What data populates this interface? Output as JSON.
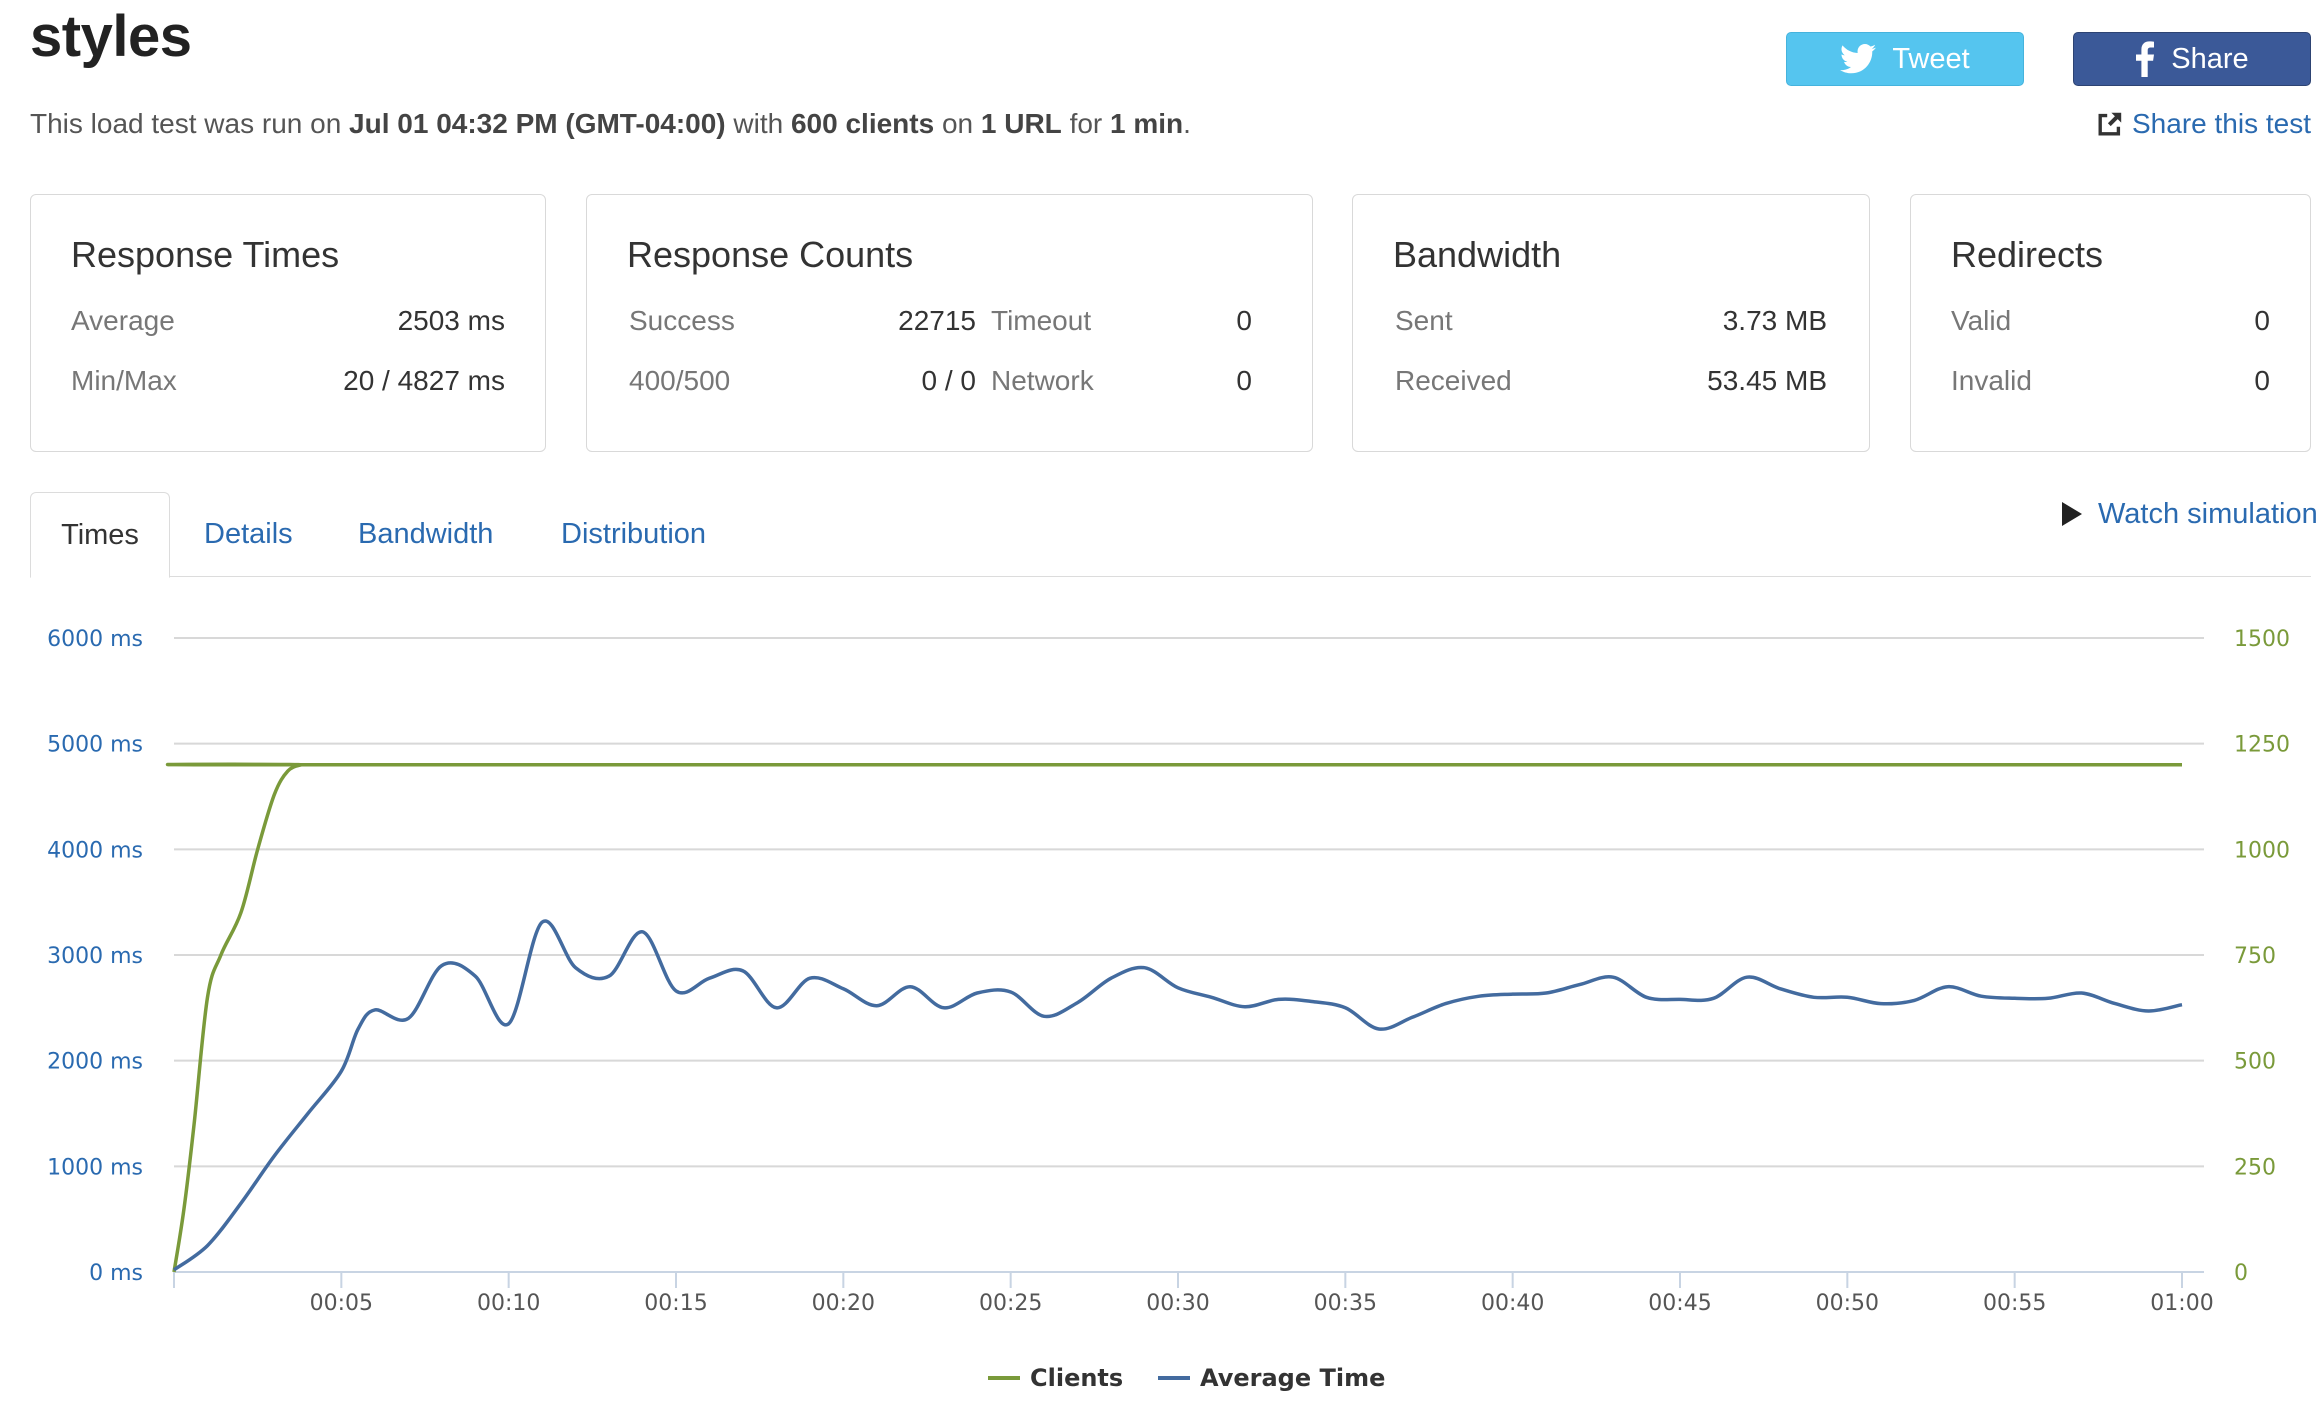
{
  "page": {
    "title": "styles",
    "summary": {
      "prefix": "This load test was run on ",
      "date": "Jul 01 04:32 PM (GMT-04:00)",
      "with": " with ",
      "clients": "600 clients",
      "on": " on ",
      "urls": "1 URL",
      "for": " for ",
      "duration": "1 min",
      "end": "."
    }
  },
  "social": {
    "tweet_label": "Tweet",
    "share_label": "Share",
    "share_test_label": "Share this test",
    "tweet_color": "#55c5ef",
    "facebook_color": "#3b5998"
  },
  "cards": {
    "response_times": {
      "title": "Response Times",
      "average_label": "Average",
      "average_value": "2503 ms",
      "minmax_label": "Min/Max",
      "minmax_value": "20 / 4827 ms"
    },
    "response_counts": {
      "title": "Response Counts",
      "success_label": "Success",
      "success_value": "22715",
      "timeout_label": "Timeout",
      "timeout_value": "0",
      "errors_label": "400/500",
      "errors_value": "0 / 0",
      "network_label": "Network",
      "network_value": "0"
    },
    "bandwidth": {
      "title": "Bandwidth",
      "sent_label": "Sent",
      "sent_value": "3.73 MB",
      "received_label": "Received",
      "received_value": "53.45 MB"
    },
    "redirects": {
      "title": "Redirects",
      "valid_label": "Valid",
      "valid_value": "0",
      "invalid_label": "Invalid",
      "invalid_value": "0"
    }
  },
  "tabs": [
    {
      "label": "Times",
      "active": true
    },
    {
      "label": "Details",
      "active": false
    },
    {
      "label": "Bandwidth",
      "active": false
    },
    {
      "label": "Distribution",
      "active": false
    }
  ],
  "watch_simulation_label": "Watch simulation",
  "chart_data": {
    "type": "line",
    "y_left_ticks": [
      "0 ms",
      "1000 ms",
      "2000 ms",
      "3000 ms",
      "4000 ms",
      "5000 ms",
      "6000 ms"
    ],
    "y_left_range": [
      0,
      6000
    ],
    "y_right_ticks": [
      "0",
      "250",
      "500",
      "750",
      "1000",
      "1250",
      "1500"
    ],
    "y_right_range": [
      0,
      1500
    ],
    "x_ticks": [
      "00:05",
      "00:10",
      "00:15",
      "00:20",
      "00:25",
      "00:30",
      "00:35",
      "00:40",
      "00:45",
      "00:50",
      "00:55",
      "01:00"
    ],
    "x_range_seconds": [
      0,
      60
    ],
    "grid": true,
    "legend_position": "bottom-center",
    "series": [
      {
        "name": "Clients",
        "axis": "right",
        "color": "#7a9a3a",
        "x": [
          0,
          0.3,
          0.6,
          1,
          1.4,
          2,
          2.5,
          3,
          3.4,
          3.8,
          4,
          60
        ],
        "values": [
          0,
          150,
          350,
          650,
          750,
          850,
          1000,
          1130,
          1185,
          1200,
          1200,
          1200
        ]
      },
      {
        "name": "Average Time",
        "axis": "left",
        "color": "#436b9f",
        "x": [
          0,
          1,
          2,
          3,
          4,
          5,
          5.5,
          6,
          7,
          8,
          9,
          10,
          11,
          12,
          13,
          14,
          15,
          16,
          17,
          18,
          19,
          20,
          21,
          22,
          23,
          24,
          25,
          26,
          27,
          28,
          29,
          30,
          31,
          32,
          33,
          34,
          35,
          36,
          37,
          38,
          39,
          40,
          41,
          42,
          43,
          44,
          45,
          46,
          47,
          48,
          49,
          50,
          51,
          52,
          53,
          54,
          55,
          56,
          57,
          58,
          59,
          60
        ],
        "values": [
          20,
          250,
          650,
          1100,
          1500,
          1900,
          2300,
          2480,
          2400,
          2900,
          2800,
          2350,
          3310,
          2880,
          2800,
          3220,
          2660,
          2780,
          2850,
          2500,
          2780,
          2680,
          2520,
          2700,
          2500,
          2640,
          2650,
          2420,
          2550,
          2780,
          2880,
          2690,
          2600,
          2510,
          2580,
          2560,
          2500,
          2300,
          2410,
          2540,
          2610,
          2630,
          2640,
          2720,
          2790,
          2600,
          2580,
          2590,
          2790,
          2680,
          2600,
          2600,
          2540,
          2570,
          2700,
          2610,
          2590,
          2590,
          2640,
          2540,
          2470,
          2530
        ]
      }
    ]
  }
}
